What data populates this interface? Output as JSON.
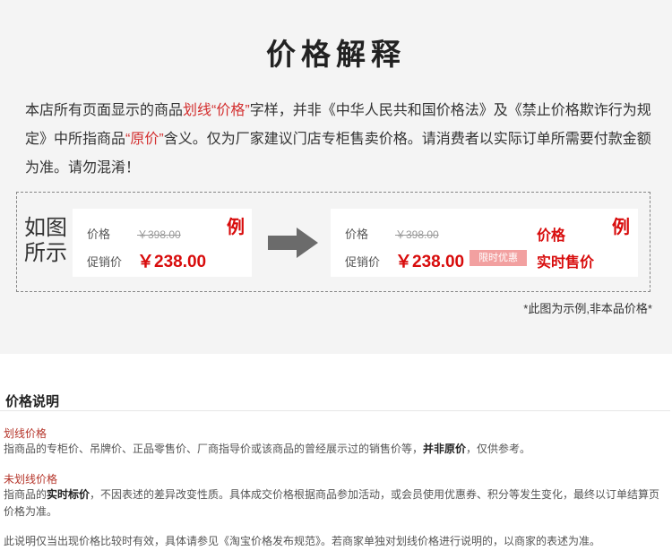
{
  "header": {
    "title": "价格解释"
  },
  "intro": {
    "p1": "本店所有页面显示的商品",
    "p2": "划线",
    "p3": "“价格”",
    "p4": "字样，并非《中华人民共和国价格法》及《禁止价格欺诈行为规定》中所指商品",
    "p5": "“原价”",
    "p6": "含义。仅为厂家建议门店专柜售卖价格。请消费者以实际订单所需要付款金额为准。请勿混淆！"
  },
  "example": {
    "label_line1": "如图",
    "label_line2": "所示",
    "tag": "例",
    "price_label": "价格",
    "old_price": "￥398.00",
    "promo_label": "促销价",
    "new_price": "￥238.00",
    "promo_badge": "限时优惠",
    "side_price": "价格",
    "side_actual": "实时售价",
    "note": "*此图为示例,非本品价格*"
  },
  "explain": {
    "title": "价格说明",
    "term1": "划线价格",
    "desc1_a": "指商品的专柜价、吊牌价、正品零售价、厂商指导价或该商品的曾经展示过的销售价等，",
    "desc1_b": "并非原价",
    "desc1_c": "，仅供参考。",
    "term2": "未划线价格",
    "desc2_a": "指商品的",
    "desc2_b": "实时标价",
    "desc2_c": "，不因表述的差异改变性质。具体成交价格根据商品参加活动，或会员使用优惠券、积分等发生变化，最终以订单结算页价格为准。",
    "desc3": "此说明仅当出现价格比较时有效，具体请参见《淘宝价格发布规范》。若商家单独对划线价格进行说明的，以商家的表述为准。"
  }
}
